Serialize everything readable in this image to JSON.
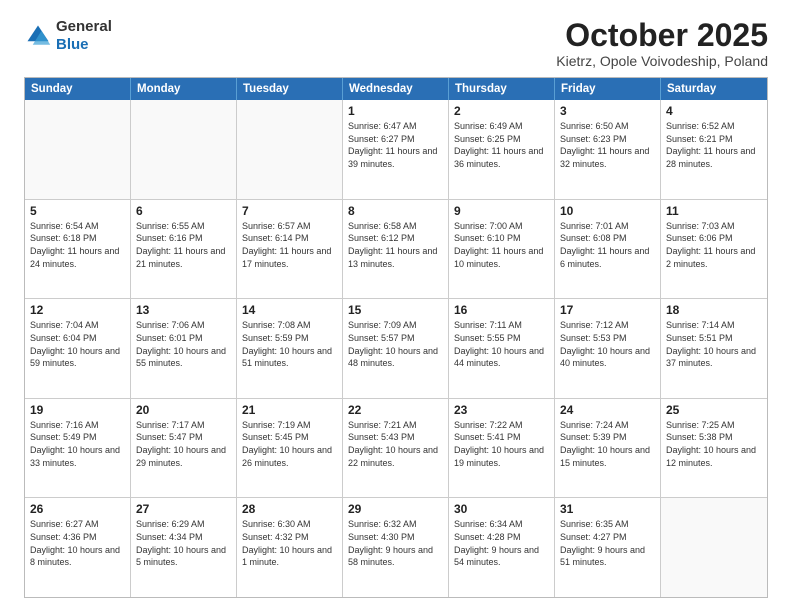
{
  "logo": {
    "general": "General",
    "blue": "Blue"
  },
  "header": {
    "title": "October 2025",
    "subtitle": "Kietrz, Opole Voivodeship, Poland"
  },
  "weekdays": [
    "Sunday",
    "Monday",
    "Tuesday",
    "Wednesday",
    "Thursday",
    "Friday",
    "Saturday"
  ],
  "weeks": [
    [
      {
        "day": "",
        "info": ""
      },
      {
        "day": "",
        "info": ""
      },
      {
        "day": "",
        "info": ""
      },
      {
        "day": "1",
        "info": "Sunrise: 6:47 AM\nSunset: 6:27 PM\nDaylight: 11 hours\nand 39 minutes."
      },
      {
        "day": "2",
        "info": "Sunrise: 6:49 AM\nSunset: 6:25 PM\nDaylight: 11 hours\nand 36 minutes."
      },
      {
        "day": "3",
        "info": "Sunrise: 6:50 AM\nSunset: 6:23 PM\nDaylight: 11 hours\nand 32 minutes."
      },
      {
        "day": "4",
        "info": "Sunrise: 6:52 AM\nSunset: 6:21 PM\nDaylight: 11 hours\nand 28 minutes."
      }
    ],
    [
      {
        "day": "5",
        "info": "Sunrise: 6:54 AM\nSunset: 6:18 PM\nDaylight: 11 hours\nand 24 minutes."
      },
      {
        "day": "6",
        "info": "Sunrise: 6:55 AM\nSunset: 6:16 PM\nDaylight: 11 hours\nand 21 minutes."
      },
      {
        "day": "7",
        "info": "Sunrise: 6:57 AM\nSunset: 6:14 PM\nDaylight: 11 hours\nand 17 minutes."
      },
      {
        "day": "8",
        "info": "Sunrise: 6:58 AM\nSunset: 6:12 PM\nDaylight: 11 hours\nand 13 minutes."
      },
      {
        "day": "9",
        "info": "Sunrise: 7:00 AM\nSunset: 6:10 PM\nDaylight: 11 hours\nand 10 minutes."
      },
      {
        "day": "10",
        "info": "Sunrise: 7:01 AM\nSunset: 6:08 PM\nDaylight: 11 hours\nand 6 minutes."
      },
      {
        "day": "11",
        "info": "Sunrise: 7:03 AM\nSunset: 6:06 PM\nDaylight: 11 hours\nand 2 minutes."
      }
    ],
    [
      {
        "day": "12",
        "info": "Sunrise: 7:04 AM\nSunset: 6:04 PM\nDaylight: 10 hours\nand 59 minutes."
      },
      {
        "day": "13",
        "info": "Sunrise: 7:06 AM\nSunset: 6:01 PM\nDaylight: 10 hours\nand 55 minutes."
      },
      {
        "day": "14",
        "info": "Sunrise: 7:08 AM\nSunset: 5:59 PM\nDaylight: 10 hours\nand 51 minutes."
      },
      {
        "day": "15",
        "info": "Sunrise: 7:09 AM\nSunset: 5:57 PM\nDaylight: 10 hours\nand 48 minutes."
      },
      {
        "day": "16",
        "info": "Sunrise: 7:11 AM\nSunset: 5:55 PM\nDaylight: 10 hours\nand 44 minutes."
      },
      {
        "day": "17",
        "info": "Sunrise: 7:12 AM\nSunset: 5:53 PM\nDaylight: 10 hours\nand 40 minutes."
      },
      {
        "day": "18",
        "info": "Sunrise: 7:14 AM\nSunset: 5:51 PM\nDaylight: 10 hours\nand 37 minutes."
      }
    ],
    [
      {
        "day": "19",
        "info": "Sunrise: 7:16 AM\nSunset: 5:49 PM\nDaylight: 10 hours\nand 33 minutes."
      },
      {
        "day": "20",
        "info": "Sunrise: 7:17 AM\nSunset: 5:47 PM\nDaylight: 10 hours\nand 29 minutes."
      },
      {
        "day": "21",
        "info": "Sunrise: 7:19 AM\nSunset: 5:45 PM\nDaylight: 10 hours\nand 26 minutes."
      },
      {
        "day": "22",
        "info": "Sunrise: 7:21 AM\nSunset: 5:43 PM\nDaylight: 10 hours\nand 22 minutes."
      },
      {
        "day": "23",
        "info": "Sunrise: 7:22 AM\nSunset: 5:41 PM\nDaylight: 10 hours\nand 19 minutes."
      },
      {
        "day": "24",
        "info": "Sunrise: 7:24 AM\nSunset: 5:39 PM\nDaylight: 10 hours\nand 15 minutes."
      },
      {
        "day": "25",
        "info": "Sunrise: 7:25 AM\nSunset: 5:38 PM\nDaylight: 10 hours\nand 12 minutes."
      }
    ],
    [
      {
        "day": "26",
        "info": "Sunrise: 6:27 AM\nSunset: 4:36 PM\nDaylight: 10 hours\nand 8 minutes."
      },
      {
        "day": "27",
        "info": "Sunrise: 6:29 AM\nSunset: 4:34 PM\nDaylight: 10 hours\nand 5 minutes."
      },
      {
        "day": "28",
        "info": "Sunrise: 6:30 AM\nSunset: 4:32 PM\nDaylight: 10 hours\nand 1 minute."
      },
      {
        "day": "29",
        "info": "Sunrise: 6:32 AM\nSunset: 4:30 PM\nDaylight: 9 hours\nand 58 minutes."
      },
      {
        "day": "30",
        "info": "Sunrise: 6:34 AM\nSunset: 4:28 PM\nDaylight: 9 hours\nand 54 minutes."
      },
      {
        "day": "31",
        "info": "Sunrise: 6:35 AM\nSunset: 4:27 PM\nDaylight: 9 hours\nand 51 minutes."
      },
      {
        "day": "",
        "info": ""
      }
    ]
  ]
}
